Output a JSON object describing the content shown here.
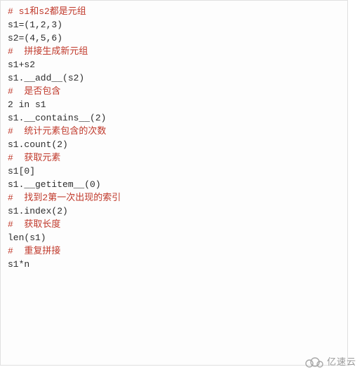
{
  "lines": [
    {
      "type": "comment",
      "text": "# s1和s2都是元组"
    },
    {
      "type": "code",
      "text": "s1=(1,2,3)"
    },
    {
      "type": "code",
      "text": "s2=(4,5,6)"
    },
    {
      "type": "blank",
      "text": ""
    },
    {
      "type": "comment",
      "text": "#  拼接生成新元组"
    },
    {
      "type": "code",
      "text": "s1+s2"
    },
    {
      "type": "code",
      "text": "s1.__add__(s2)"
    },
    {
      "type": "blank",
      "text": ""
    },
    {
      "type": "comment",
      "text": "#  是否包含"
    },
    {
      "type": "code",
      "text": "2 in s1"
    },
    {
      "type": "code",
      "text": "s1.__contains__(2)"
    },
    {
      "type": "blank",
      "text": ""
    },
    {
      "type": "comment",
      "text": "#  统计元素包含的次数"
    },
    {
      "type": "code",
      "text": "s1.count(2)"
    },
    {
      "type": "blank",
      "text": ""
    },
    {
      "type": "comment",
      "text": "#  获取元素"
    },
    {
      "type": "code",
      "text": "s1[0]"
    },
    {
      "type": "code",
      "text": "s1.__getitem__(0)"
    },
    {
      "type": "blank",
      "text": ""
    },
    {
      "type": "comment",
      "text": "#  找到2第一次出现的索引"
    },
    {
      "type": "code",
      "text": "s1.index(2)"
    },
    {
      "type": "blank",
      "text": ""
    },
    {
      "type": "comment",
      "text": "#  获取长度"
    },
    {
      "type": "code",
      "text": "len(s1)"
    },
    {
      "type": "blank",
      "text": ""
    },
    {
      "type": "comment",
      "text": "#  重复拼接"
    },
    {
      "type": "code",
      "text": "s1*n"
    }
  ],
  "watermark": {
    "label": "亿速云",
    "icon_name": "cloud-icon"
  }
}
